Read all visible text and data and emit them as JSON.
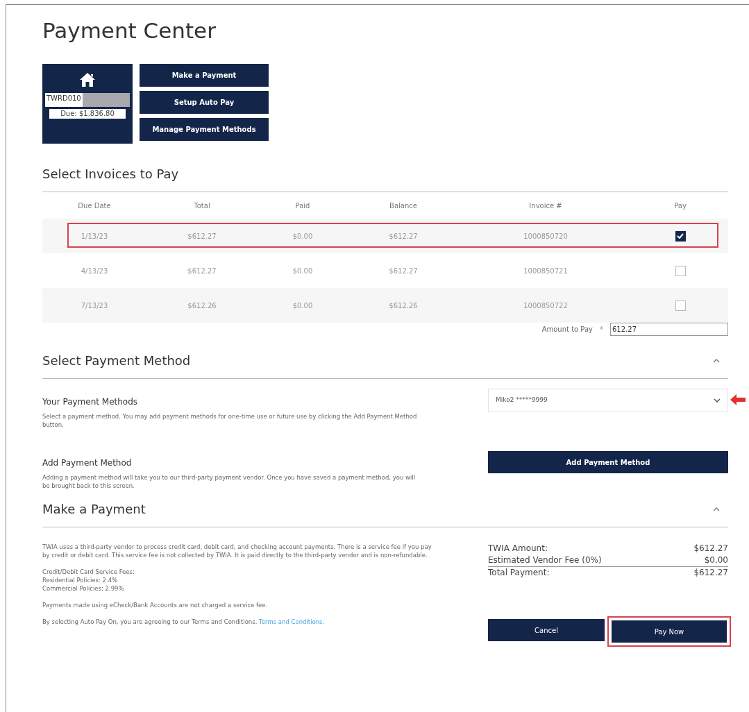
{
  "title": "Payment Center",
  "account": {
    "id": "TWRD010",
    "redacted": true,
    "due": "Due: $1,836.80"
  },
  "nav_buttons": [
    "Make a Payment",
    "Setup Auto Pay",
    "Manage Payment Methods"
  ],
  "invoices": {
    "title": "Select Invoices to Pay",
    "columns": [
      "Due Date",
      "Total",
      "Paid",
      "Balance",
      "Invoice #",
      "Pay"
    ],
    "rows": [
      {
        "cells": [
          "1/13/23",
          "$612.27",
          "$0.00",
          "$612.27",
          "1000850720"
        ],
        "checked": true,
        "highlighted": true
      },
      {
        "cells": [
          "4/13/23",
          "$612.27",
          "$0.00",
          "$612.27",
          "1000850721"
        ],
        "checked": false,
        "highlighted": false
      },
      {
        "cells": [
          "7/13/23",
          "$612.26",
          "$0.00",
          "$612.26",
          "1000850722"
        ],
        "checked": false,
        "highlighted": false
      }
    ],
    "amount_label": "Amount to Pay",
    "required_mark": "*",
    "amount_value": "612.27"
  },
  "payment_method": {
    "title": "Select Payment Method",
    "expanded": true,
    "your_methods_title": "Your Payment Methods",
    "your_methods_text": "Select a payment method. You may add payment methods for one-time use or future use by clicking the Add Payment Method button.",
    "selected_method": "Miko2 *****9999",
    "pointer_arrow": true,
    "add_title": "Add Payment Method",
    "add_text": "Adding a payment method will take you to our third-party payment vendor. Once you have saved a payment method, you will be brought back to this screen.",
    "add_button": "Add Payment Method"
  },
  "make_payment": {
    "title": "Make a Payment",
    "expanded": true,
    "paragraphs": [
      "TWIA uses a third-party vendor to process credit card, debit card, and checking account payments. There is a service fee if you pay by credit or debit card. This service fee is not collected by TWIA. It is paid directly to the third-party vendor and is non-refundable."
    ],
    "fee_lines": [
      "Credit/Debit Card Service Fees:",
      "Residential Policies: 2.4%",
      "Commercial Policies: 2.99%"
    ],
    "echeck_note": "Payments made using eCheck/Bank Accounts are not charged a service fee.",
    "terms_text": "By selecting Auto Pay On, you are agreeing to our Terms and Conditions.",
    "terms_link": "Terms and Conditions.",
    "summary": [
      {
        "label": "TWIA Amount:",
        "value": "$612.27"
      },
      {
        "label": "Estimated Vendor Fee (0%)",
        "value": "$0.00"
      },
      {
        "label": "Total Payment:",
        "value": "$612.27"
      }
    ],
    "cancel_button": "Cancel",
    "pay_button": "Pay Now",
    "pay_highlighted": true
  }
}
